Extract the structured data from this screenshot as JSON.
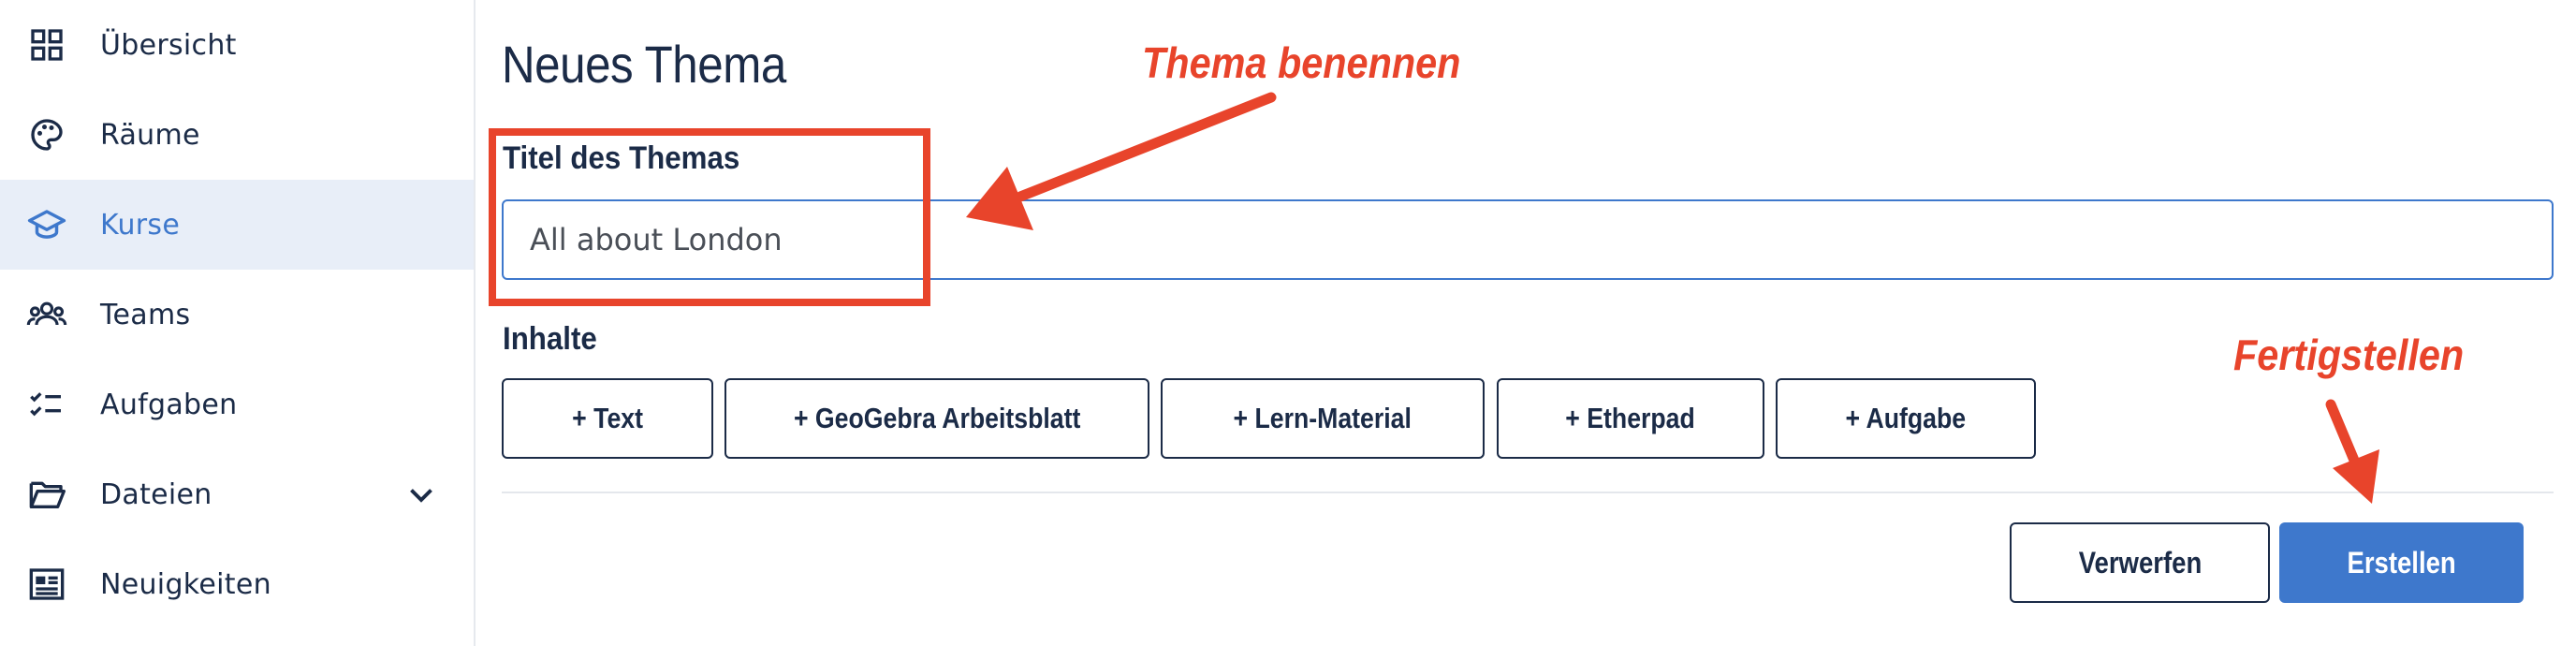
{
  "sidebar": {
    "items": [
      {
        "label": "Übersicht",
        "icon": "dashboard-grid-icon"
      },
      {
        "label": "Räume",
        "icon": "palette-icon"
      },
      {
        "label": "Kurse",
        "icon": "graduation-cap-icon",
        "active": true
      },
      {
        "label": "Teams",
        "icon": "people-group-icon"
      },
      {
        "label": "Aufgaben",
        "icon": "checklist-icon"
      },
      {
        "label": "Dateien",
        "icon": "folder-open-icon",
        "expandable": true
      },
      {
        "label": "Neuigkeiten",
        "icon": "newspaper-icon"
      }
    ]
  },
  "main": {
    "title": "Neues Thema",
    "topic_title_label": "Titel des Themas",
    "topic_title_value": "All about London",
    "contents_label": "Inhalte",
    "add_buttons": [
      "+ Text",
      "+ GeoGebra Arbeitsblatt",
      "+ Lern-Material",
      "+ Etherpad",
      "+ Aufgabe"
    ],
    "discard_label": "Verwerfen",
    "create_label": "Erstellen"
  },
  "annotations": {
    "name_topic": "Thema benennen",
    "finish": "Fertigstellen",
    "color": "#e8442b"
  },
  "colors": {
    "primary": "#3e78cc",
    "text": "#1b2b47",
    "active_bg": "#e8eef8"
  }
}
